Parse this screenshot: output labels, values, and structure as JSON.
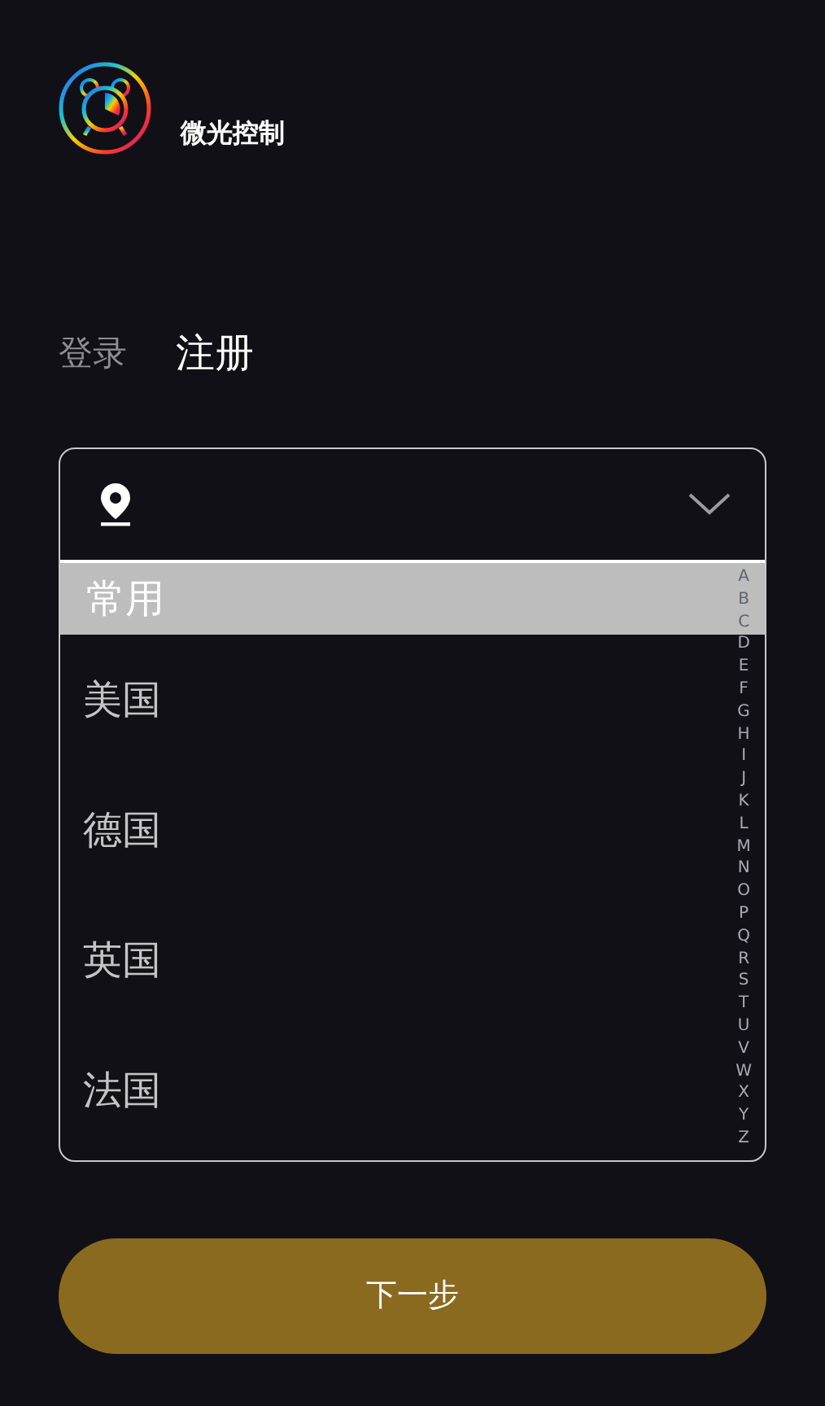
{
  "app": {
    "name": "微光控制"
  },
  "tabs": [
    {
      "label": "登录",
      "selected": false
    },
    {
      "label": "注册",
      "selected": true
    }
  ],
  "country_picker": {
    "expanded": true,
    "section": "常用",
    "countries": [
      "美国",
      "德国",
      "英国",
      "法国"
    ],
    "index": [
      "A",
      "B",
      "C",
      "D",
      "E",
      "F",
      "G",
      "H",
      "I",
      "J",
      "K",
      "L",
      "M",
      "N",
      "O",
      "P",
      "Q",
      "R",
      "S",
      "T",
      "U",
      "V",
      "W",
      "X",
      "Y",
      "Z"
    ]
  },
  "next_button": "下一步"
}
